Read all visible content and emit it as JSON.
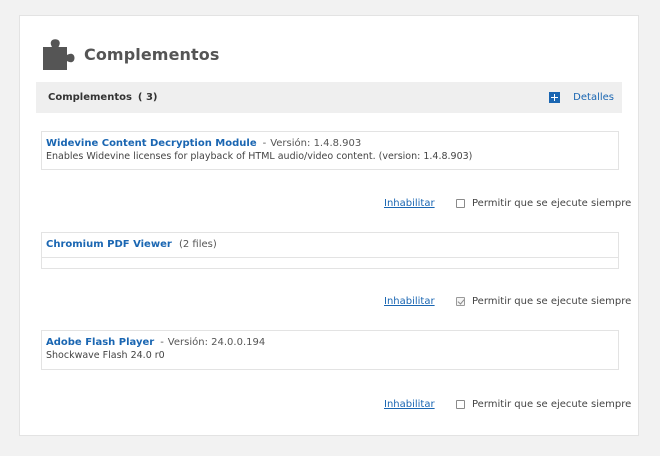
{
  "page": {
    "title": "Complementos"
  },
  "section": {
    "title": "Complementos",
    "count": "( 3)",
    "details_label": "Detalles"
  },
  "plugins": [
    {
      "name": "Widevine Content Decryption Module",
      "separator": "-",
      "version_label": "Versión:",
      "version": "1.4.8.903",
      "description": "Enables Widevine licenses for playback of HTML audio/video content. (version: 1.4.8.903)",
      "disable_label": "Inhabilitar",
      "always_allow_label": "Permitir que se ejecute siempre",
      "always_allow_checked": false
    },
    {
      "name": "Chromium PDF Viewer",
      "files": "(2 files)",
      "disable_label": "Inhabilitar",
      "always_allow_label": "Permitir que se ejecute siempre",
      "always_allow_checked": true
    },
    {
      "name": "Adobe Flash Player",
      "separator": "-",
      "version_label": "Versión:",
      "version": "24.0.0.194",
      "description": "Shockwave Flash 24.0 r0",
      "disable_label": "Inhabilitar",
      "always_allow_label": "Permitir que se ejecute siempre",
      "always_allow_checked": false
    }
  ],
  "icons": {
    "header": "puzzle-icon",
    "expand": "plus-icon"
  },
  "colors": {
    "link": "#1a66b2",
    "bar": "#efefef",
    "border": "#e3e3e3",
    "icon": "#555555"
  }
}
